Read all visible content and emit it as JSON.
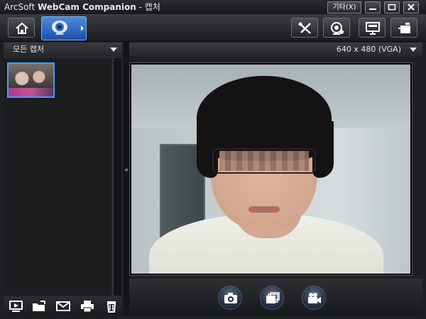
{
  "window": {
    "title_prefix": "ArcSoft ",
    "title_app": "WebCam Companion",
    "title_suffix": " - 캡처",
    "menu_label": "기타(X)",
    "minimize_icon": "minimize-icon",
    "maximize_icon": "maximize-icon",
    "close_icon": "close-icon"
  },
  "toolbar": {
    "home_icon": "home-icon",
    "capture_icon": "webcam-icon",
    "tools_icon": "tools-icon",
    "webcam_settings_icon": "webcam-settings-icon",
    "monitor_icon": "monitor-icon",
    "export_icon": "export-icon",
    "accent": "#2e6fd0"
  },
  "left_panel": {
    "filter_label": "모든 캡처",
    "bottom_icons": [
      "slideshow-icon",
      "open-folder-icon",
      "email-icon",
      "print-icon",
      "trash-icon"
    ]
  },
  "right_panel": {
    "resolution_label": "640 x 480 (VGA)",
    "capture_buttons": [
      "camera-icon",
      "burst-capture-icon",
      "video-record-icon"
    ]
  }
}
